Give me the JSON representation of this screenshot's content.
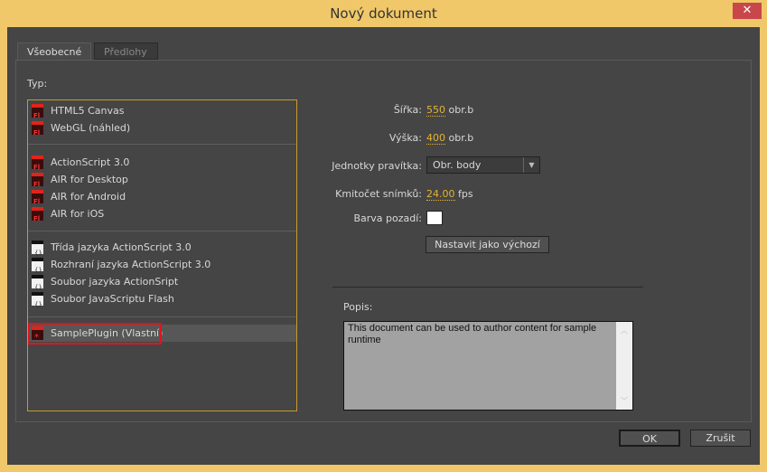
{
  "window": {
    "title": "Nový dokument",
    "close": "✕"
  },
  "tabs": [
    {
      "label": "Všeobecné"
    },
    {
      "label": "Předlohy"
    }
  ],
  "type_label": "Typ:",
  "types": [
    {
      "label": "HTML5 Canvas",
      "icon": "fl-icon"
    },
    {
      "label": "WebGL (náhled)",
      "icon": "fl-icon"
    },
    {
      "label": "ActionScript 3.0",
      "icon": "fl-icon"
    },
    {
      "label": "AIR for Desktop",
      "icon": "fl-icon"
    },
    {
      "label": "AIR for Android",
      "icon": "fl-icon"
    },
    {
      "label": "AIR for iOS",
      "icon": "fl-icon"
    },
    {
      "label": "Třída jazyka ActionScript 3.0",
      "icon": "as-file-icon"
    },
    {
      "label": "Rozhraní jazyka ActionScript 3.0",
      "icon": "as-file-icon"
    },
    {
      "label": "Soubor jazyka ActionSript",
      "icon": "as-file-icon"
    },
    {
      "label": "Soubor JavaScriptu Flash",
      "icon": "jsfl-file-icon"
    },
    {
      "label": "SamplePlugin (Vlastní)",
      "icon": "plugin-icon",
      "selected": true
    }
  ],
  "props": {
    "width_label": "Šířka:",
    "width": "550",
    "width_unit": "obr.b",
    "height_label": "Výška:",
    "height": "400",
    "height_unit": "obr.b",
    "ruler_label": "Jednotky pravítka:",
    "ruler": "Obr. body",
    "fps_label": "Kmitočet snímků:",
    "fps": "24.00",
    "fps_unit": "fps",
    "bg_label": "Barva pozadí:",
    "bg_color": "#ffffff",
    "default_button": "Nastavit jako výchozí"
  },
  "description": {
    "label": "Popis:",
    "text": "This document can be used to author content for sample runtime"
  },
  "buttons": {
    "ok": "OK",
    "cancel": "Zrušit"
  }
}
